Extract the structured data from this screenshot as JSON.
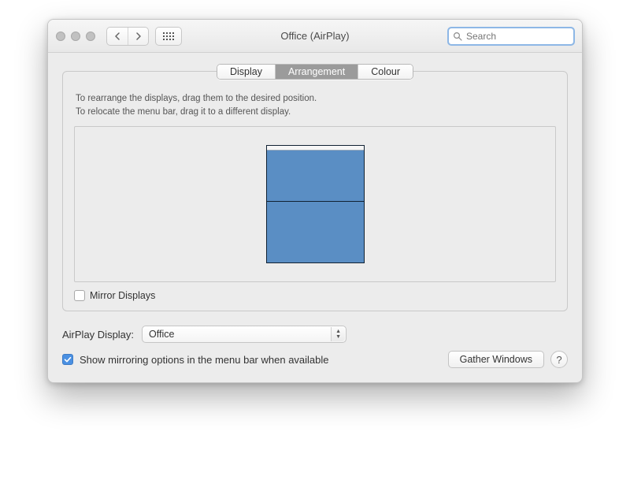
{
  "window": {
    "title": "Office (AirPlay)"
  },
  "search": {
    "placeholder": "Search"
  },
  "tabs": {
    "display": "Display",
    "arrangement": "Arrangement",
    "colour": "Colour"
  },
  "instructions": {
    "line1": "To rearrange the displays, drag them to the desired position.",
    "line2": "To relocate the menu bar, drag it to a different display."
  },
  "mirror": {
    "label": "Mirror Displays",
    "checked": false
  },
  "airplay": {
    "label": "AirPlay Display:",
    "value": "Office"
  },
  "show_mirroring": {
    "label": "Show mirroring options in the menu bar when available",
    "checked": true
  },
  "buttons": {
    "gather": "Gather Windows",
    "help": "?"
  }
}
